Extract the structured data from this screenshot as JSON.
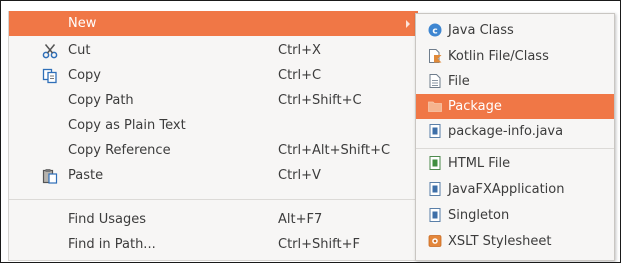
{
  "context_menu": {
    "items": [
      {
        "label": "New",
        "shortcut": ""
      },
      {
        "label": "Cut",
        "shortcut": "Ctrl+X"
      },
      {
        "label": "Copy",
        "shortcut": "Ctrl+C"
      },
      {
        "label": "Copy Path",
        "shortcut": "Ctrl+Shift+C"
      },
      {
        "label": "Copy as Plain Text",
        "shortcut": ""
      },
      {
        "label": "Copy Reference",
        "shortcut": "Ctrl+Alt+Shift+C"
      },
      {
        "label": "Paste",
        "shortcut": "Ctrl+V"
      },
      {
        "label": "Find Usages",
        "shortcut": "Alt+F7"
      },
      {
        "label": "Find in Path...",
        "shortcut": "Ctrl+Shift+F"
      }
    ]
  },
  "new_submenu": {
    "items": [
      {
        "label": "Java Class",
        "icon": "java-class-icon"
      },
      {
        "label": "Kotlin File/Class",
        "icon": "kotlin-file-icon"
      },
      {
        "label": "File",
        "icon": "file-icon"
      },
      {
        "label": "Package",
        "icon": "package-icon"
      },
      {
        "label": "package-info.java",
        "icon": "java-file-icon"
      },
      {
        "label": "HTML File",
        "icon": "html-file-icon"
      },
      {
        "label": "JavaFXApplication",
        "icon": "java-file-icon"
      },
      {
        "label": "Singleton",
        "icon": "java-file-icon"
      },
      {
        "label": "XSLT Stylesheet",
        "icon": "xslt-file-icon"
      }
    ]
  },
  "colors": {
    "highlight": "#f07746",
    "menu_background": "#f7f6f5",
    "text": "#3c3c3c"
  }
}
